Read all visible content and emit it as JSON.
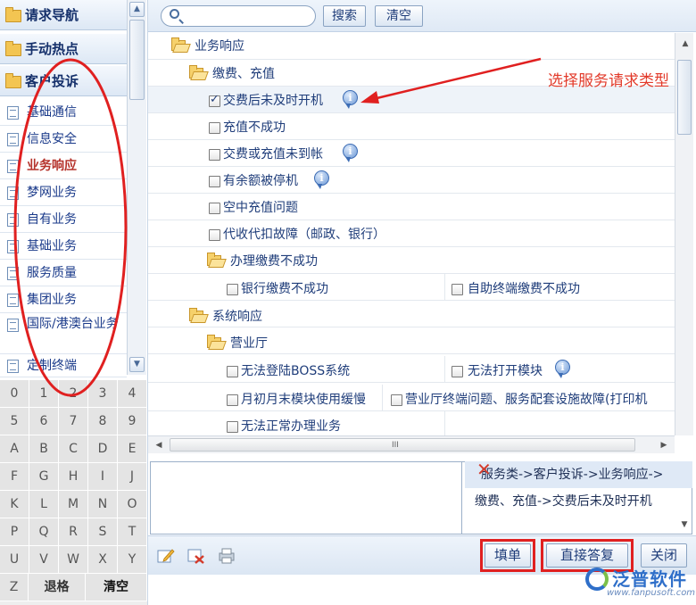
{
  "left_nav": {
    "headers": [
      "请求导航",
      "手动热点",
      "客户投诉"
    ],
    "items": [
      "基础通信",
      "信息安全",
      "业务响应",
      "梦网业务",
      "自有业务",
      "基础业务",
      "服务质量",
      "集团业务",
      "国际/港澳台业务",
      "定制终端"
    ],
    "active_index": 2
  },
  "keyboard": {
    "rows": [
      [
        "0",
        "1",
        "2",
        "3",
        "4"
      ],
      [
        "5",
        "6",
        "7",
        "8",
        "9"
      ],
      [
        "A",
        "B",
        "C",
        "D",
        "E"
      ],
      [
        "F",
        "G",
        "H",
        "I",
        "J"
      ],
      [
        "K",
        "L",
        "M",
        "N",
        "O"
      ],
      [
        "P",
        "Q",
        "R",
        "S",
        "T"
      ],
      [
        "U",
        "V",
        "W",
        "X",
        "Y"
      ]
    ],
    "last_row": [
      "Z",
      "退格",
      "清空"
    ]
  },
  "toolbar": {
    "search_value": "",
    "search_label": "搜索",
    "clear_label": "清空"
  },
  "tree": {
    "root": "业务响应",
    "group1": "缴费、充值",
    "g1_items": [
      "交费后未及时开机",
      "充值不成功",
      "交费或充值未到帐",
      "有余额被停机",
      "空中充值问题",
      "代收代扣故障（邮政、银行）"
    ],
    "g1_checked_index": 0,
    "sub1": "办理缴费不成功",
    "sub1_items": [
      "银行缴费不成功",
      "自助终端缴费不成功"
    ],
    "group2": "系统响应",
    "sub2": "营业厅",
    "sub2_items": [
      "无法登陆BOSS系统",
      "无法打开模块",
      "月初月末模块使用缓慢",
      "营业厅终端问题、服务配套设施故障(打印机",
      "无法正常办理业务"
    ],
    "hscroll_grip": "III"
  },
  "annotation": {
    "text": "选择服务请求类型"
  },
  "path": {
    "line1": "服务类->客户投诉->业务响应->",
    "line2": "缴费、充值->交费后未及时开机",
    "delete_glyph": "✕"
  },
  "buttons": {
    "fill": "填单",
    "reply": "直接答复",
    "close": "关闭"
  },
  "logo": {
    "name": "泛普软件",
    "url": "www.fanpusoft.com"
  },
  "colors": {
    "accent_red": "#e02020",
    "nav_text": "#1a3a8a",
    "active_text": "#b5322b",
    "tree_text": "#1f3d7a"
  }
}
